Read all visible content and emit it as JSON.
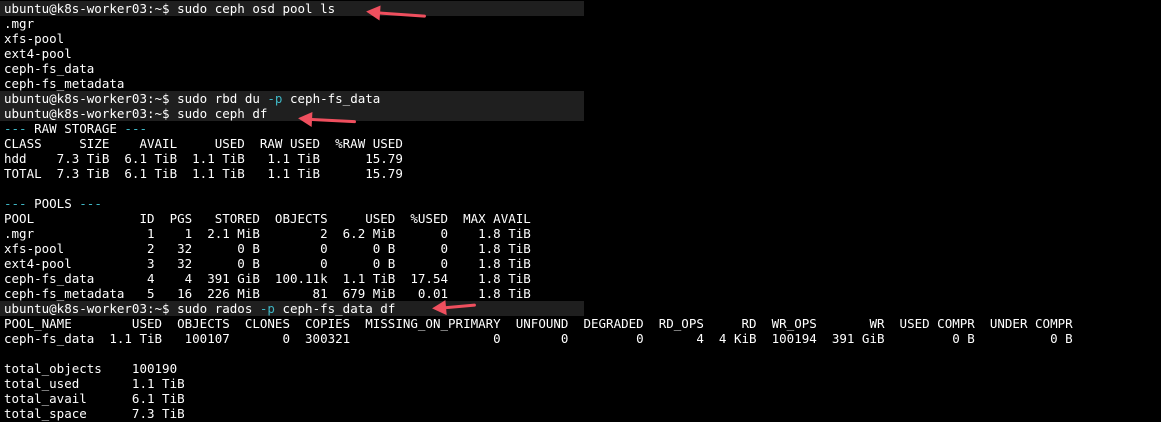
{
  "terminal": {
    "prompt": "ubuntu@k8s-worker03:~$ ",
    "cmd1": "sudo ceph osd pool ls",
    "pools": [
      ".mgr",
      "xfs-pool",
      "ext4-pool",
      "ceph-fs_data",
      "ceph-fs_metadata"
    ],
    "cmd2_pre": "sudo rbd du ",
    "cmd2_flag": "-p",
    "cmd2_post": " ceph-fs_data",
    "cmd3": "sudo ceph df",
    "raw_header_dashes_left": "--- ",
    "raw_header_title": "RAW STORAGE",
    "raw_header_dashes_right": " ---",
    "raw_cols": "CLASS     SIZE    AVAIL     USED  RAW USED  %RAW USED",
    "raw_rows": [
      "hdd    7.3 TiB  6.1 TiB  1.1 TiB   1.1 TiB      15.79",
      "TOTAL  7.3 TiB  6.1 TiB  1.1 TiB   1.1 TiB      15.79"
    ],
    "pools_header_dashes_left": "--- ",
    "pools_header_title": "POOLS",
    "pools_header_dashes_right": " ---",
    "pools_cols": "POOL              ID  PGS   STORED  OBJECTS     USED  %USED  MAX AVAIL",
    "pools_rows": [
      ".mgr               1    1  2.1 MiB        2  6.2 MiB      0    1.8 TiB",
      "xfs-pool           2   32      0 B        0      0 B      0    1.8 TiB",
      "ext4-pool          3   32      0 B        0      0 B      0    1.8 TiB",
      "ceph-fs_data       4    4  391 GiB  100.11k  1.1 TiB  17.54    1.8 TiB",
      "ceph-fs_metadata   5   16  226 MiB       81  679 MiB   0.01    1.8 TiB"
    ],
    "cmd4_pre": "sudo rados ",
    "cmd4_flag": "-p",
    "cmd4_post": " ceph-fs_data df",
    "rados_cols": "POOL_NAME        USED  OBJECTS  CLONES  COPIES  MISSING_ON_PRIMARY  UNFOUND  DEGRADED  RD_OPS     RD  WR_OPS       WR  USED COMPR  UNDER COMPR",
    "rados_row": "ceph-fs_data  1.1 TiB   100107       0  300321                   0        0         0       4  4 KiB  100194  391 GiB         0 B          0 B",
    "totals": [
      "total_objects    100190",
      "total_used       1.1 TiB",
      "total_avail      6.1 TiB",
      "total_space      7.3 TiB"
    ]
  },
  "colors": {
    "background": "#000000",
    "text": "#ffffff",
    "flag": "#3fb6c4",
    "annotation_arrow": "#ef4f5e"
  }
}
